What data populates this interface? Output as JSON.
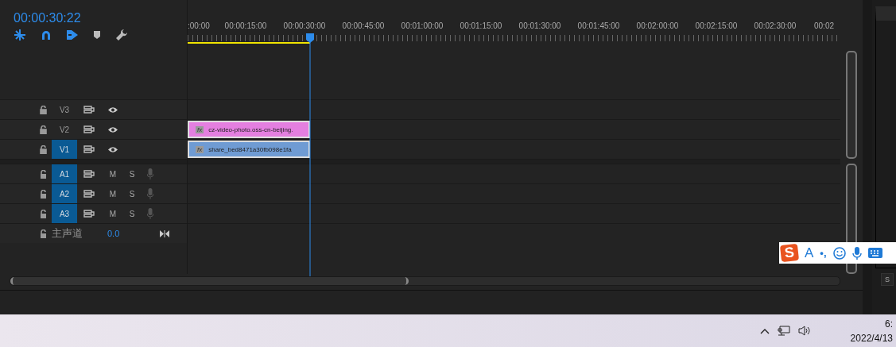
{
  "timecode": "00:00:30:22",
  "tools": [
    {
      "kind": "snap",
      "on": true
    },
    {
      "kind": "magnet",
      "on": true
    },
    {
      "kind": "linked",
      "on": true
    },
    {
      "kind": "marker",
      "on": false
    },
    {
      "kind": "wrench",
      "on": false
    }
  ],
  "ruler": {
    "labels": [
      ":00:00",
      "00:00:15:00",
      "00:00:30:00",
      "00:00:45:00",
      "00:01:00:00",
      "00:01:15:00",
      "00:01:30:00",
      "00:01:45:00",
      "00:02:00:00",
      "00:02:15:00",
      "00:02:30:00",
      "00:02"
    ]
  },
  "playhead": {
    "level": 0.188
  },
  "work_area": {
    "level": 0.188
  },
  "tracks": [
    {
      "name": "V3",
      "kind": "video",
      "targeted": false
    },
    {
      "name": "V2",
      "kind": "video",
      "targeted": false,
      "clip": {
        "label": "cz-video-photo.oss-cn-beijing.",
        "color": "#e47fe0",
        "fx": "fx"
      }
    },
    {
      "name": "V1",
      "kind": "video",
      "targeted": true,
      "clip": {
        "label": "share_bed8471a30fb098e1fa",
        "color": "#6f9bd3",
        "fx": "fx"
      }
    },
    {
      "name": "A1",
      "kind": "audio",
      "targeted": true,
      "mute": "M",
      "solo": "S"
    },
    {
      "name": "A2",
      "kind": "audio",
      "targeted": true,
      "mute": "M",
      "solo": "S"
    },
    {
      "name": "A3",
      "kind": "audio",
      "targeted": true,
      "mute": "M",
      "solo": "S"
    }
  ],
  "master": {
    "label": "主声道",
    "value": "0.0"
  },
  "right_panel": {
    "button": "S"
  },
  "ime_toolbar": {
    "logo": "S",
    "mode": "A",
    "punct": "•,"
  },
  "taskbar": {
    "time": "6:",
    "date": "2022/4/13"
  }
}
